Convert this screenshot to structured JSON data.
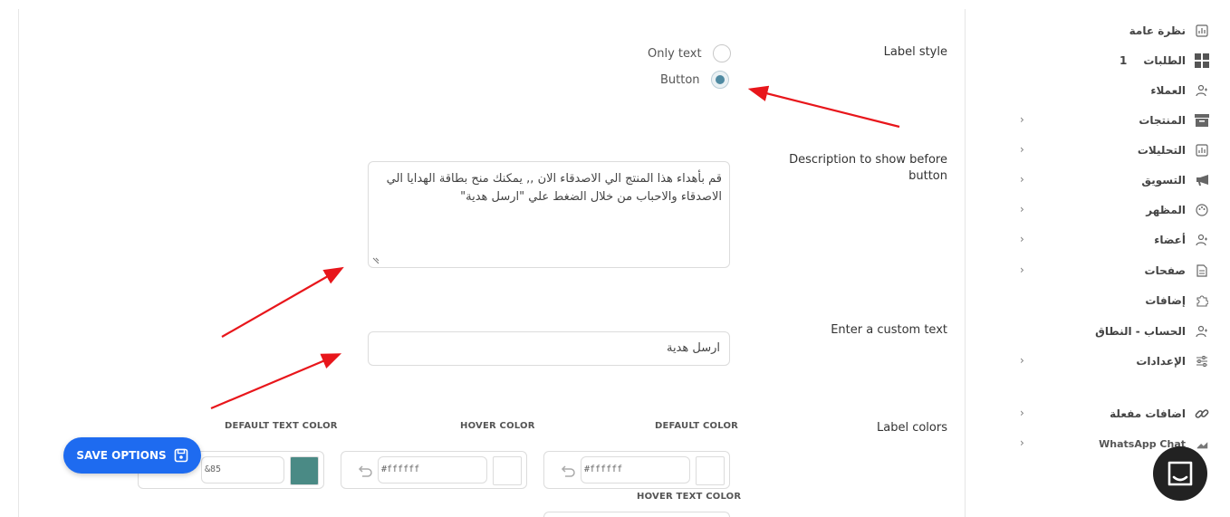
{
  "settings": {
    "label_style": {
      "label": "Label style",
      "options": [
        "Only text",
        "Button"
      ],
      "selected": "Button"
    },
    "description": {
      "label": "Description to show before button",
      "value": "قم بأهداء هذا المنتج الي الاصدقاء الان ,, يمكنك منح بطاقة الهدايا الي الاصدقاء والاحباب من خلال الضغط علي \"ارسل هدية\""
    },
    "custom_text": {
      "label": "Enter a custom text",
      "value": "ارسل هدية"
    },
    "label_colors": {
      "label": "Label colors",
      "default_color": {
        "title": "DEFAULT COLOR",
        "value": "#ffffff",
        "swatch": "#ffffff"
      },
      "hover_color": {
        "title": "HOVER COLOR",
        "value": "#ffffff",
        "swatch": "#ffffff"
      },
      "default_text_color": {
        "title": "DEFAULT TEXT COLOR",
        "value": "&85",
        "swatch": "#4a8a85"
      },
      "hover_text_color": {
        "title": "HOVER TEXT COLOR"
      }
    }
  },
  "save_button": {
    "label": "SAVE OPTIONS",
    "color": "#1e6bf0"
  },
  "sidebar": {
    "items": [
      {
        "label": "نظرة عامة",
        "icon": "chart-icon",
        "chevron": false
      },
      {
        "label": "الطلبات",
        "icon": "grid-icon",
        "badge": "1",
        "chevron": false
      },
      {
        "label": "العملاء",
        "icon": "users-icon",
        "chevron": false
      },
      {
        "label": "المنتجات",
        "icon": "box-icon",
        "chevron": true
      },
      {
        "label": "التحليلات",
        "icon": "chart-icon",
        "chevron": true
      },
      {
        "label": "التسويق",
        "icon": "megaphone-icon",
        "chevron": true
      },
      {
        "label": "المظهر",
        "icon": "palette-icon",
        "chevron": true
      },
      {
        "label": "أعضاء",
        "icon": "users-icon",
        "chevron": true
      },
      {
        "label": "صفحات",
        "icon": "page-icon",
        "chevron": true
      },
      {
        "label": "إضافات",
        "icon": "puzzle-icon",
        "chevron": false
      },
      {
        "label": "الحساب - النطاق",
        "icon": "users-icon",
        "chevron": false
      },
      {
        "label": "الإعدادات",
        "icon": "sliders-icon",
        "chevron": true
      },
      {
        "label": "اضافات مفعلة",
        "icon": "link-icon",
        "chevron": true
      },
      {
        "label": "WhatsApp Chat",
        "icon": "phone-icon",
        "chevron": true
      }
    ]
  }
}
